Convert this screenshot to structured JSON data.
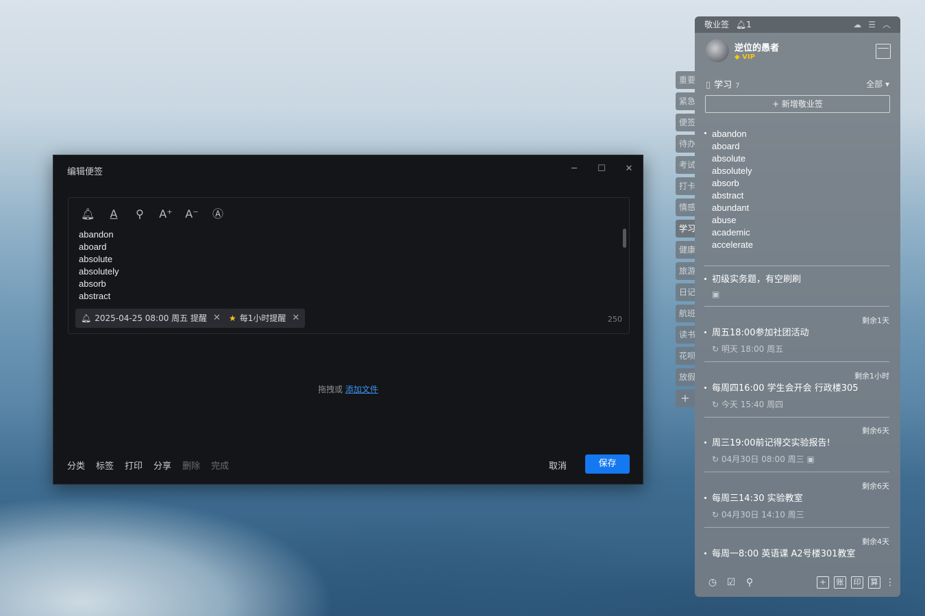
{
  "editor": {
    "title": "编辑便签",
    "content_lines": [
      "abandon",
      "aboard",
      "absolute",
      "absolutely",
      "absorb",
      "abstract"
    ],
    "chip_reminder": "2025-04-25 08:00 周五 提醒",
    "chip_repeat": "每1小时提醒",
    "char_count": "250",
    "drop_text": "拖拽或",
    "drop_link": "添加文件",
    "bottom": {
      "category": "分类",
      "tag": "标签",
      "print": "打印",
      "share": "分享",
      "delete": "删除",
      "done": "完成"
    },
    "cancel": "取消",
    "save": "保存"
  },
  "side_tabs": [
    "重要",
    "紧急",
    "便签",
    "待办",
    "考试",
    "打卡",
    "情感",
    "学习",
    "健康",
    "旅游",
    "日记",
    "航班",
    "读书",
    "花呗",
    "放假",
    "+"
  ],
  "panel": {
    "app_name": "敬业签",
    "bell_count": "1",
    "username": "逆位的愚者",
    "vip": "VIP",
    "category": "学习",
    "category_count": "7",
    "filter": "全部",
    "new_button": "+ 新增敬业签",
    "word_list": [
      "abandon",
      "aboard",
      "absolute",
      "absolutely",
      "absorb",
      "abstract",
      "abundant",
      "abuse",
      "academic",
      "accelerate"
    ],
    "notes": [
      {
        "text": "初级实务题，有空刷刷",
        "meta": "",
        "remain": ""
      },
      {
        "text": "周五18:00参加社团活动",
        "meta": "明天 18:00 周五",
        "remain": "剩余1天"
      },
      {
        "text": "每周四16:00 学生会开会 行政楼305",
        "meta": "今天 15:40 周四",
        "remain": "剩余1小时"
      },
      {
        "text": "周三19:00前记得交实验报告!",
        "meta": "04月30日 08:00 周三",
        "remain": "剩余6天"
      },
      {
        "text": "每周三14:30 实验教室",
        "meta": "04月30日 14:10 周三",
        "remain": "剩余6天"
      },
      {
        "text": "每周一8:00 英语课  A2号楼301教室",
        "meta": "",
        "remain": "剩余4天"
      }
    ],
    "bottom_boxes": [
      "+",
      "账",
      "印",
      "算"
    ]
  },
  "colors": {
    "accent": "#1478f0",
    "editor_bg": "#141518",
    "panel_bg": "#767e85"
  }
}
